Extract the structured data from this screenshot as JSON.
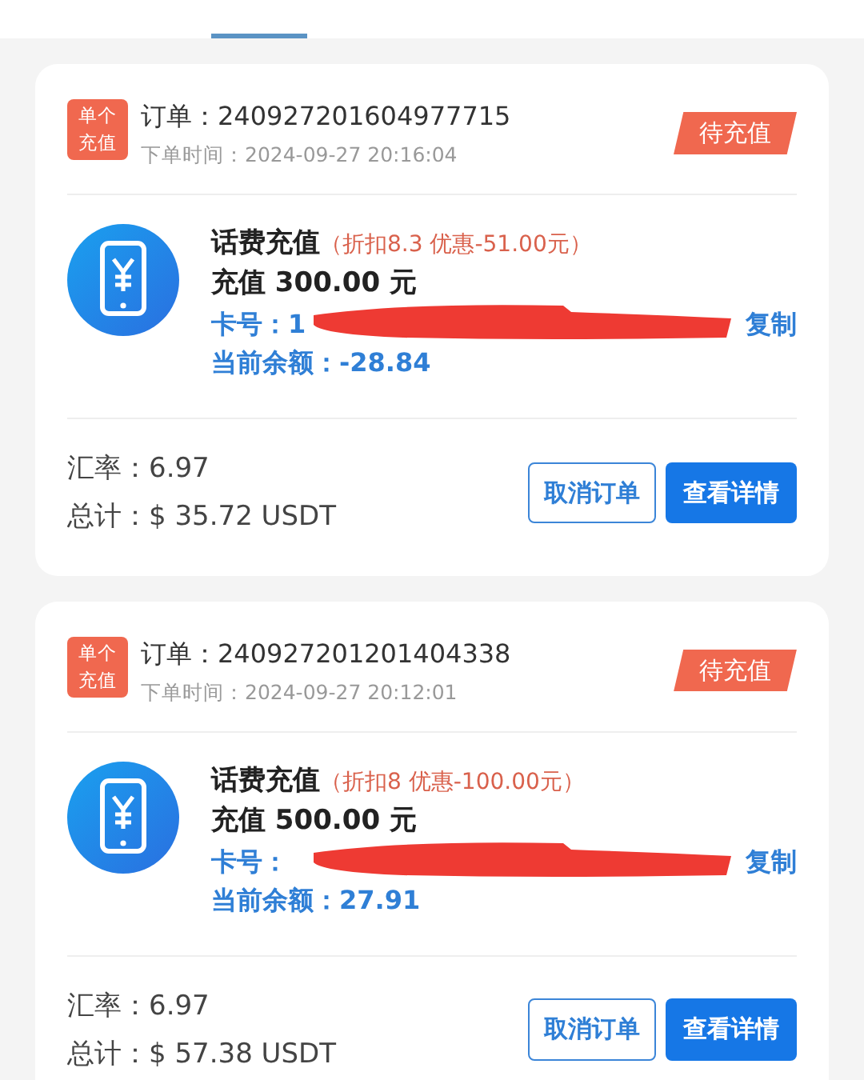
{
  "tabs": [
    {
      "selected": false
    },
    {
      "selected": true
    },
    {
      "selected": false
    },
    {
      "selected": false
    },
    {
      "selected": false
    }
  ],
  "orders": [
    {
      "type_badge": "单个充值",
      "order_label": "订单：",
      "order_no": "240927201604977715",
      "time_label": "下单时间：",
      "time": "2024-09-27  20:16:04",
      "status": "待充值",
      "product": "话费充值",
      "discount": "（折扣8.3  优惠-51.00元）",
      "amount_label": "充值",
      "amount": "300.00",
      "amount_unit": "元",
      "card_label": "卡号：",
      "card_visible": "1",
      "redacted": true,
      "copy": "复制",
      "balance_label": "当前余额：",
      "balance": "-28.84",
      "rate_label": "汇率：",
      "rate": "6.97",
      "total_label": "总计：",
      "total": "$  35.72  USDT",
      "buttons": [
        "取消订单",
        "查看详情"
      ]
    },
    {
      "type_badge": "单个充值",
      "order_label": "订单：",
      "order_no": "240927201201404338",
      "time_label": "下单时间：",
      "time": "2024-09-27  20:12:01",
      "status": "待充值",
      "product": "话费充值",
      "discount": "（折扣8  优惠-100.00元）",
      "amount_label": "充值",
      "amount": "500.00",
      "amount_unit": "元",
      "card_label": "卡号：",
      "redacted": true,
      "copy": "复制",
      "balance_label": "当前余额：",
      "balance": "27.91",
      "rate_label": "汇率：",
      "rate": "6.97",
      "total_label": "总计：",
      "total": "$  57.38  USDT",
      "buttons": [
        "取消订单",
        "查看详情"
      ]
    }
  ]
}
